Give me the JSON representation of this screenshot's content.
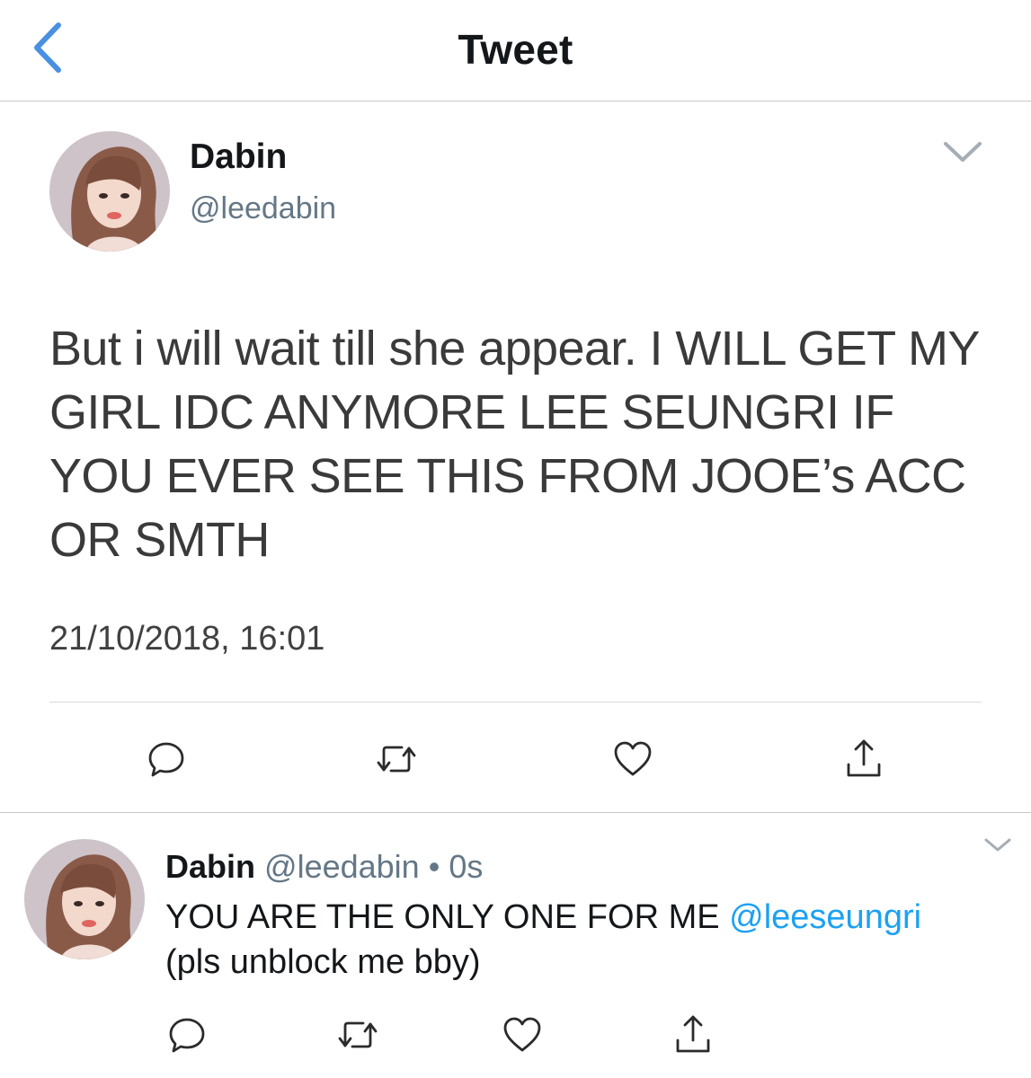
{
  "header": {
    "title": "Tweet",
    "back_icon": "chevron-left-icon",
    "accent_color": "#4a90e2"
  },
  "main_tweet": {
    "author_name": "Dabin",
    "author_handle": "@leedabin",
    "text": "But i will wait till she appear. I WILL GET MY GIRL IDC ANYMORE LEE SEUNGRI IF YOU EVER SEE THIS FROM JOOE’s ACC OR SMTH",
    "timestamp": "21/10/2018, 16:01",
    "actions": [
      "reply-icon",
      "retweet-icon",
      "like-icon",
      "share-icon"
    ]
  },
  "reply_tweet": {
    "author_name": "Dabin",
    "author_handle": "@leedabin",
    "separator": "•",
    "time_ago": "0s",
    "text_before": "YOU ARE THE ONLY ONE FOR ME ",
    "mention": "@leeseungri",
    "text_after": "(pls unblock me bby)",
    "mention_color": "#1da1f2",
    "actions": [
      "reply-icon",
      "retweet-icon",
      "like-icon",
      "share-icon"
    ]
  }
}
